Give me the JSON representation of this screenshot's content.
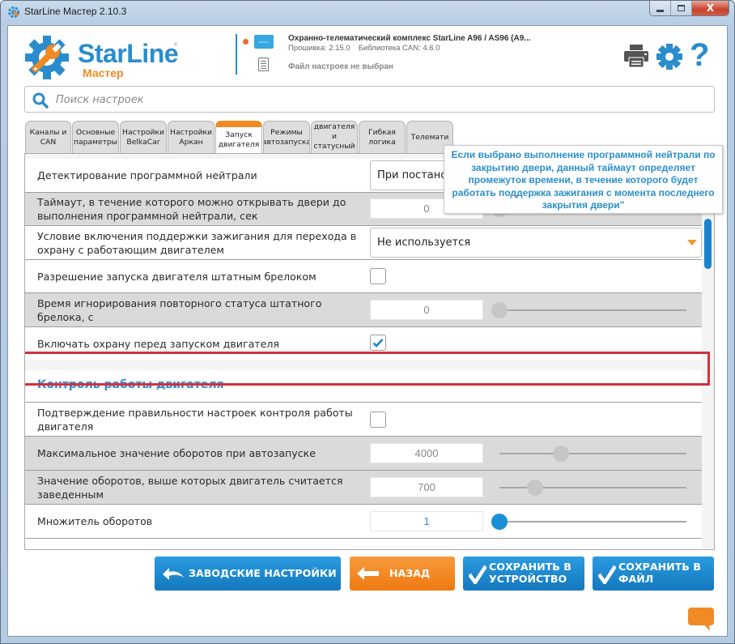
{
  "window": {
    "title": "StarLine Мастер 2.10.3",
    "minimize_label": "minimize",
    "maximize_label": "maximize",
    "close_label": "X"
  },
  "header": {
    "logo_text": "StarLine",
    "logo_sub": "Мастер",
    "logo_tm": "®",
    "device_title": "Охранно-телематический комплекс StarLine A96 / AS96 (A9...",
    "firmware": "Прошивка: 2.15.0",
    "can_library": "Библиотека CAN: 4.6.0",
    "file_status": "Файл настроек не выбран",
    "help_glyph": "?",
    "connection_status_color": "#ea6d2a"
  },
  "search": {
    "placeholder": "Поиск настроек",
    "value": ""
  },
  "tabs": [
    {
      "label": "Каналы и\nCAN",
      "active": false
    },
    {
      "label": "Основные\nпараметры",
      "active": false
    },
    {
      "label": "Настройки\nBelkaCar",
      "active": false
    },
    {
      "label": "Настройки\nАркан",
      "active": false
    },
    {
      "label": "Запуск\nдвигателя",
      "active": true
    },
    {
      "label": "Режимы\nавтозапуска",
      "active": false
    },
    {
      "label": "двигателя\nи\nстатусный",
      "active": false
    },
    {
      "label": "Гибкая\nлогика",
      "active": false
    },
    {
      "label": "Телемати",
      "active": false
    }
  ],
  "tooltip": {
    "text": "Если выбрано выполнение программной нейтрали по закрытию двери, данный таймаут определяет промежуток времени, в течение которого будет работать поддержка зажигания с момента последнего закрытия двери\""
  },
  "settings": {
    "rows": [
      {
        "label": "Детектирование программной нейтрали",
        "type": "select",
        "value": "При постано"
      },
      {
        "label": "Таймаут, в течение которого можно открывать двери до выполнения программной нейтрали, сек",
        "type": "slider",
        "value": "0",
        "fraction": 0.0
      },
      {
        "label": "Условие включения поддержки зажигания для перехода в охрану с работающим двигателем",
        "type": "select",
        "value": "Не используется"
      },
      {
        "label": "Разрешение запуска двигателя штатным брелоком",
        "type": "checkbox",
        "checked": false
      },
      {
        "label": "Время игнорирования повторного статуса штатного брелока, с",
        "type": "slider",
        "value": "0",
        "fraction": 0.0
      },
      {
        "label": "Включать охрану перед запуском двигателя",
        "type": "checkbox",
        "checked": true,
        "highlighted": true
      }
    ],
    "section_title": "Контроль работы двигателя",
    "section_rows": [
      {
        "label": "Подтверждение правильности настроек контроля работы двигателя",
        "type": "checkbox",
        "checked": false
      },
      {
        "label": "Максимальное значение оборотов при автозапуске",
        "type": "slider",
        "value": "4000",
        "fraction": 0.33
      },
      {
        "label": "Значение оборотов, выше которых двигатель считается заведенным",
        "type": "slider",
        "value": "700",
        "fraction": 0.19
      },
      {
        "label": "Множитель оборотов",
        "type": "slider",
        "value": "1",
        "fraction": 0.0,
        "active": true
      }
    ]
  },
  "buttons": {
    "factory": "ЗАВОДСКИЕ НАСТРОЙКИ",
    "back": "НАЗАД",
    "save_device": "СОХРАНИТЬ В\nУСТРОЙСТВО",
    "save_file": "СОХРАНИТЬ В\nФАЙЛ"
  },
  "colors": {
    "brand_blue": "#2a8ccd",
    "accent_orange": "#f08a24",
    "highlight_red": "#d5303c"
  }
}
